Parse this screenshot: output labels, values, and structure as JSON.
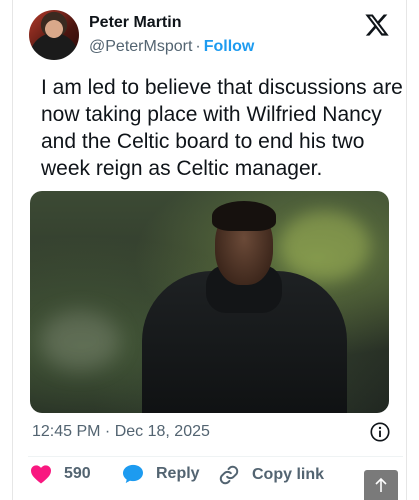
{
  "author": {
    "name": "Peter Martin",
    "handle": "@PeterMsport",
    "separator": "·",
    "follow_label": "Follow"
  },
  "tweet": {
    "text": "I am led to believe that discussions are now taking place with Wilfried Nancy and the Celtic board to end his two week reign as Celtic manager.",
    "timestamp": "12:45 PM · Dec 18, 2025"
  },
  "actions": {
    "like_count": "590",
    "reply_label": "Reply",
    "copy_link_label": "Copy link"
  },
  "icons": {
    "brand": "x-logo-icon",
    "info": "info-icon",
    "like": "heart-icon",
    "reply": "speech-bubble-icon",
    "copy": "link-icon",
    "scroll": "arrow-up-icon"
  },
  "colors": {
    "accent": "#1d9bf0",
    "like": "#f91880",
    "muted": "#536471",
    "text": "#0f1419"
  }
}
